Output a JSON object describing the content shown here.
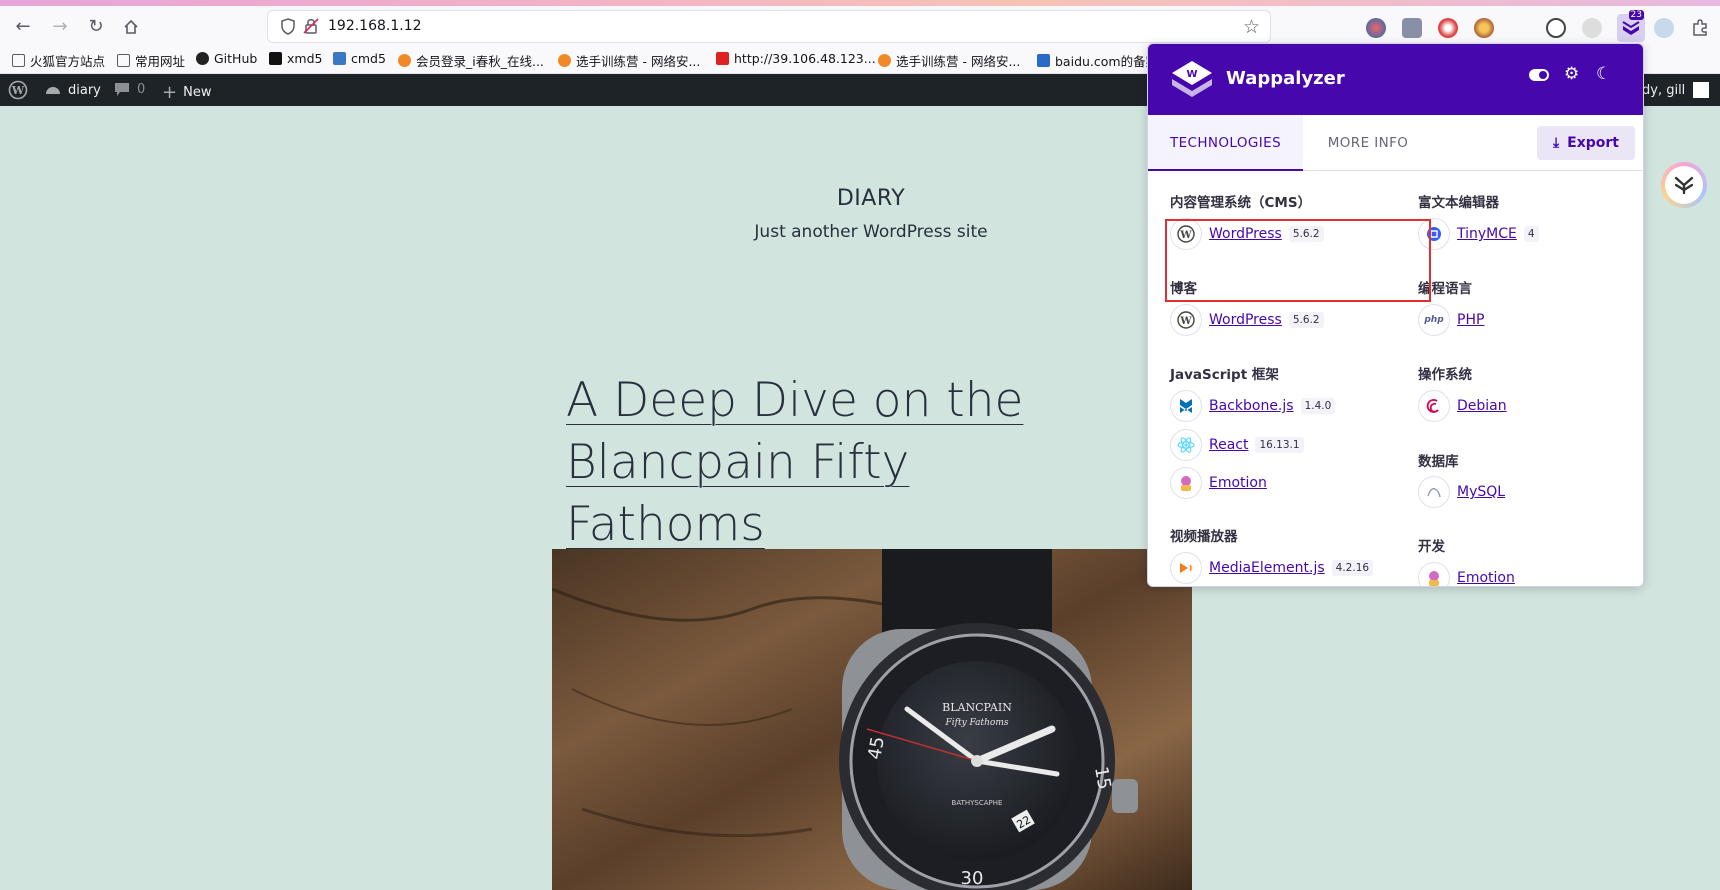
{
  "browser": {
    "url": "192.168.1.12",
    "ext_badge": "23",
    "bookmarks": [
      "火狐官方站点",
      "常用网址",
      "GitHub",
      "xmd5",
      "cmd5",
      "会员登录_i春秋_在线...",
      "选手训练营 - 网络安...",
      "http://39.106.48.123...",
      "选手训练营 - 网络安...",
      "baidu.com的备案"
    ]
  },
  "adminbar": {
    "site": "diary",
    "comments": "0",
    "new": "New",
    "howdy": "dy, gill"
  },
  "page": {
    "site_title": "DIARY",
    "site_desc": "Just another WordPress site",
    "post_title": "A Deep Dive on the Blancpain Fifty Fathoms",
    "watch": {
      "brand": "BLANCPAIN",
      "model": "Fifty Fathoms",
      "sub": "BATHYSCAPHE",
      "date": "22",
      "n45": "45",
      "n15": "15",
      "n30": "30"
    }
  },
  "wappalyzer": {
    "name": "Wappalyzer",
    "tab_technologies": "TECHNOLOGIES",
    "tab_more_info": "MORE INFO",
    "export": "Export",
    "left": [
      {
        "category": "内容管理系统（CMS）",
        "items": [
          {
            "name": "WordPress",
            "version": "5.6.2",
            "icon": "wordpress-icon"
          }
        ]
      },
      {
        "category": "博客",
        "items": [
          {
            "name": "WordPress",
            "version": "5.6.2",
            "icon": "wordpress-icon"
          }
        ]
      },
      {
        "category": "JavaScript 框架",
        "items": [
          {
            "name": "Backbone.js",
            "version": "1.4.0",
            "icon": "backbone-icon"
          },
          {
            "name": "React",
            "version": "16.13.1",
            "icon": "react-icon"
          },
          {
            "name": "Emotion",
            "version": "",
            "icon": "emotion-icon"
          }
        ]
      },
      {
        "category": "视频播放器",
        "items": [
          {
            "name": "MediaElement.js",
            "version": "4.2.16",
            "icon": "mediaelement-icon"
          }
        ]
      }
    ],
    "right": [
      {
        "category": "富文本编辑器",
        "items": [
          {
            "name": "TinyMCE",
            "version": "4",
            "icon": "tinymce-icon"
          }
        ]
      },
      {
        "category": "编程语言",
        "items": [
          {
            "name": "PHP",
            "version": "",
            "icon": "php-icon"
          }
        ]
      },
      {
        "category": "操作系统",
        "items": [
          {
            "name": "Debian",
            "version": "",
            "icon": "debian-icon"
          }
        ]
      },
      {
        "category": "数据库",
        "items": [
          {
            "name": "MySQL",
            "version": "",
            "icon": "mysql-icon"
          }
        ]
      },
      {
        "category": "开发",
        "items": [
          {
            "name": "Emotion",
            "version": "",
            "icon": "emotion-icon"
          }
        ]
      }
    ]
  }
}
